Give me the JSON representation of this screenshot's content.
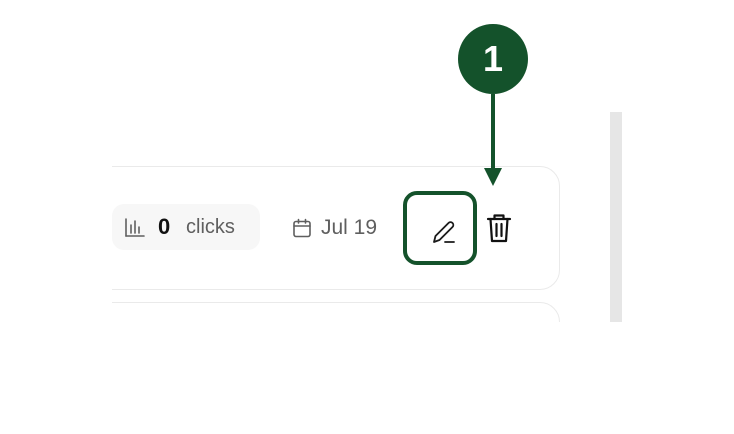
{
  "link_row": {
    "clicks_count": "0",
    "clicks_label": "clicks",
    "date": "Jul 19"
  },
  "icons": {
    "clicks": "bar-chart-icon",
    "date": "calendar-icon",
    "edit": "pencil-icon",
    "delete": "trash-icon"
  },
  "callout": {
    "number": "1"
  },
  "colors": {
    "accent": "#14522b",
    "muted_text": "#5f5f5f",
    "pill_bg": "#f7f7f7",
    "card_border": "#eaeaea"
  }
}
